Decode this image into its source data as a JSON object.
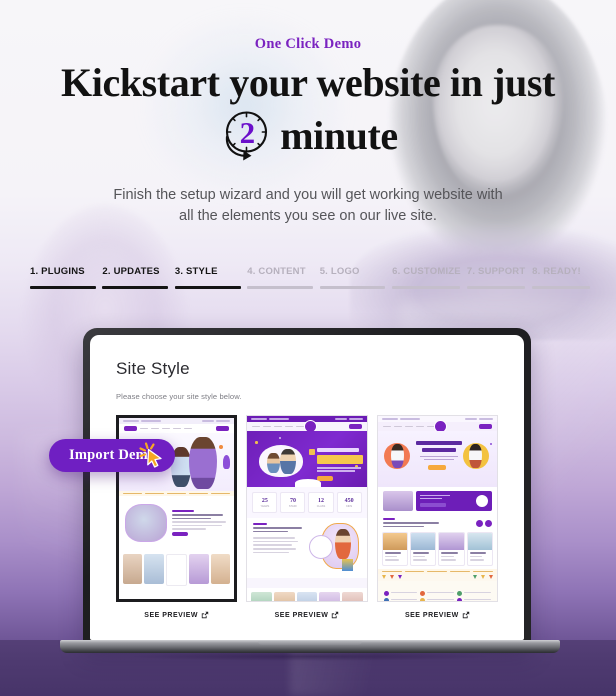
{
  "hero": {
    "eyebrow": "One Click Demo",
    "headline_line1": "Kickstart your website in just",
    "clock_number": "2",
    "headline_line2_tail": "minute",
    "subcopy_line1": "Finish the setup wizard and you will get working website with",
    "subcopy_line2": "all the elements you see on our live site.",
    "accent_color": "#7a22c0"
  },
  "steps": [
    {
      "label": "1. PLUGINS",
      "state": "done"
    },
    {
      "label": "2. UPDATES",
      "state": "done"
    },
    {
      "label": "3. STYLE",
      "state": "done"
    },
    {
      "label": "4. CONTENT",
      "state": "todo"
    },
    {
      "label": "5. LOGO",
      "state": "todo"
    },
    {
      "label": "6. CUSTOMIZE",
      "state": "todo"
    },
    {
      "label": "7. SUPPORT",
      "state": "todo"
    },
    {
      "label": "8. READY!",
      "state": "todo"
    }
  ],
  "wizard": {
    "title": "Site Style",
    "subtitle": "Please choose your site style below.",
    "cards": [
      {
        "preview_label": "SEE PREVIEW",
        "selected": true,
        "style_name": "kindergarten-light"
      },
      {
        "preview_label": "SEE PREVIEW",
        "selected": false,
        "style_name": "excellence-purple"
      },
      {
        "preview_label": "SEE PREVIEW",
        "selected": false,
        "style_name": "be-safe-be-kind"
      }
    ]
  },
  "mini_sites": {
    "card2_heading_line1": "A Tradition Of",
    "card2_heading_line2": "Excellence.",
    "card2_stats": [
      {
        "value": "25",
        "label": "YEARS"
      },
      {
        "value": "70",
        "label": "STAFF"
      },
      {
        "value": "12",
        "label": "CLASS"
      },
      {
        "value": "450",
        "label": "KIDS"
      }
    ],
    "card3_heading_line1": "Be safe. Be kind.",
    "card3_heading_line2": "Be smart."
  },
  "import_button": {
    "label": "Import Demo",
    "bg_color": "#6f1fc2",
    "cursor_icon": "pointer-cursor-icon"
  },
  "colors": {
    "purple": "#7a22c0",
    "deep_purple": "#6b0fcb",
    "dark": "#141414",
    "muted": "#b6b0bd",
    "desk": "#4e3a70"
  }
}
